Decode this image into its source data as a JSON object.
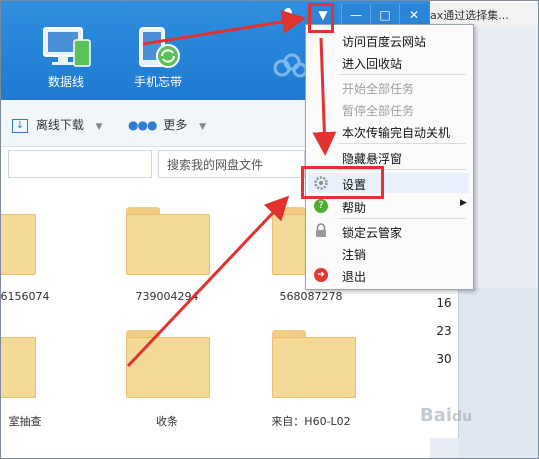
{
  "header": {
    "tiles": [
      {
        "label": "数据线",
        "icon": "monitor-phone-icon"
      },
      {
        "label": "手机忘带",
        "icon": "phone-sync-icon"
      }
    ]
  },
  "window_controls": {
    "skin": "skin-icon",
    "menu": "▼",
    "minimize": "—",
    "maximize": "□",
    "close": "✕"
  },
  "external_window": {
    "title": "ax通过选择集..."
  },
  "calendar": {
    "days": [
      "16",
      "23",
      "30"
    ]
  },
  "toolbar": {
    "offline_download": "离线下载",
    "more": "更多"
  },
  "search": {
    "placeholder": "搜索我的网盘文件"
  },
  "folders": [
    {
      "name": "6156074"
    },
    {
      "name": "739004294"
    },
    {
      "name": "568087278"
    },
    {
      "name": "室抽查"
    },
    {
      "name": "收条"
    },
    {
      "name": "来自：H60-L02"
    }
  ],
  "menu": {
    "items": [
      {
        "label": "访问百度云网站",
        "enabled": true
      },
      {
        "label": "进入回收站",
        "enabled": true
      },
      {
        "label": "开始全部任务",
        "enabled": false
      },
      {
        "label": "暂停全部任务",
        "enabled": false
      },
      {
        "label": "本次传输完自动关机",
        "enabled": true
      },
      {
        "label": "隐藏悬浮窗",
        "enabled": true
      },
      {
        "label": "设置",
        "enabled": true,
        "icon": "gear-icon"
      },
      {
        "label": "帮助",
        "enabled": true,
        "icon": "help-icon"
      },
      {
        "label": "锁定云管家",
        "enabled": true,
        "icon": "lock-icon"
      },
      {
        "label": "注销",
        "enabled": true
      },
      {
        "label": "退出",
        "enabled": true,
        "icon": "exit-icon"
      }
    ]
  },
  "colors": {
    "header_blue": "#1f7ad1",
    "annotation_red": "#e2312e",
    "folder_yellow": "#f5d996"
  }
}
